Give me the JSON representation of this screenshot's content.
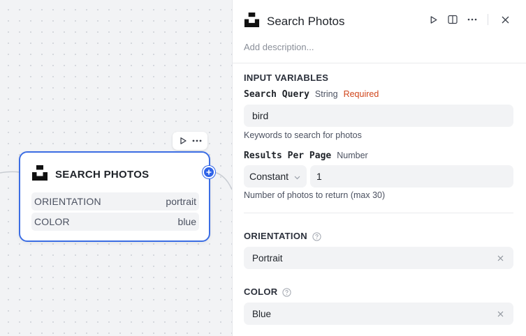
{
  "node": {
    "title": "SEARCH PHOTOS",
    "rows": [
      {
        "key": "ORIENTATION",
        "value": "portrait"
      },
      {
        "key": "COLOR",
        "value": "blue"
      }
    ]
  },
  "panel": {
    "title": "Search Photos",
    "description_placeholder": "Add description...",
    "input_variables_label": "INPUT VARIABLES",
    "search_query": {
      "name": "Search Query",
      "type": "String",
      "required": "Required",
      "value": "bird",
      "hint": "Keywords to search for photos"
    },
    "results_per_page": {
      "name": "Results Per Page",
      "type": "Number",
      "mode": "Constant",
      "value": "1",
      "hint": "Number of photos to return (max 30)"
    },
    "orientation": {
      "label": "ORIENTATION",
      "value": "Portrait"
    },
    "color": {
      "label": "COLOR",
      "value": "Blue"
    }
  },
  "colors": {
    "accent": "#3b6de4",
    "required": "#d0451b"
  },
  "icons": [
    "unsplash-logo-icon",
    "play-icon",
    "more-icon",
    "plus-icon",
    "split-view-icon",
    "close-icon",
    "chevron-down-icon",
    "help-icon",
    "clear-icon"
  ]
}
